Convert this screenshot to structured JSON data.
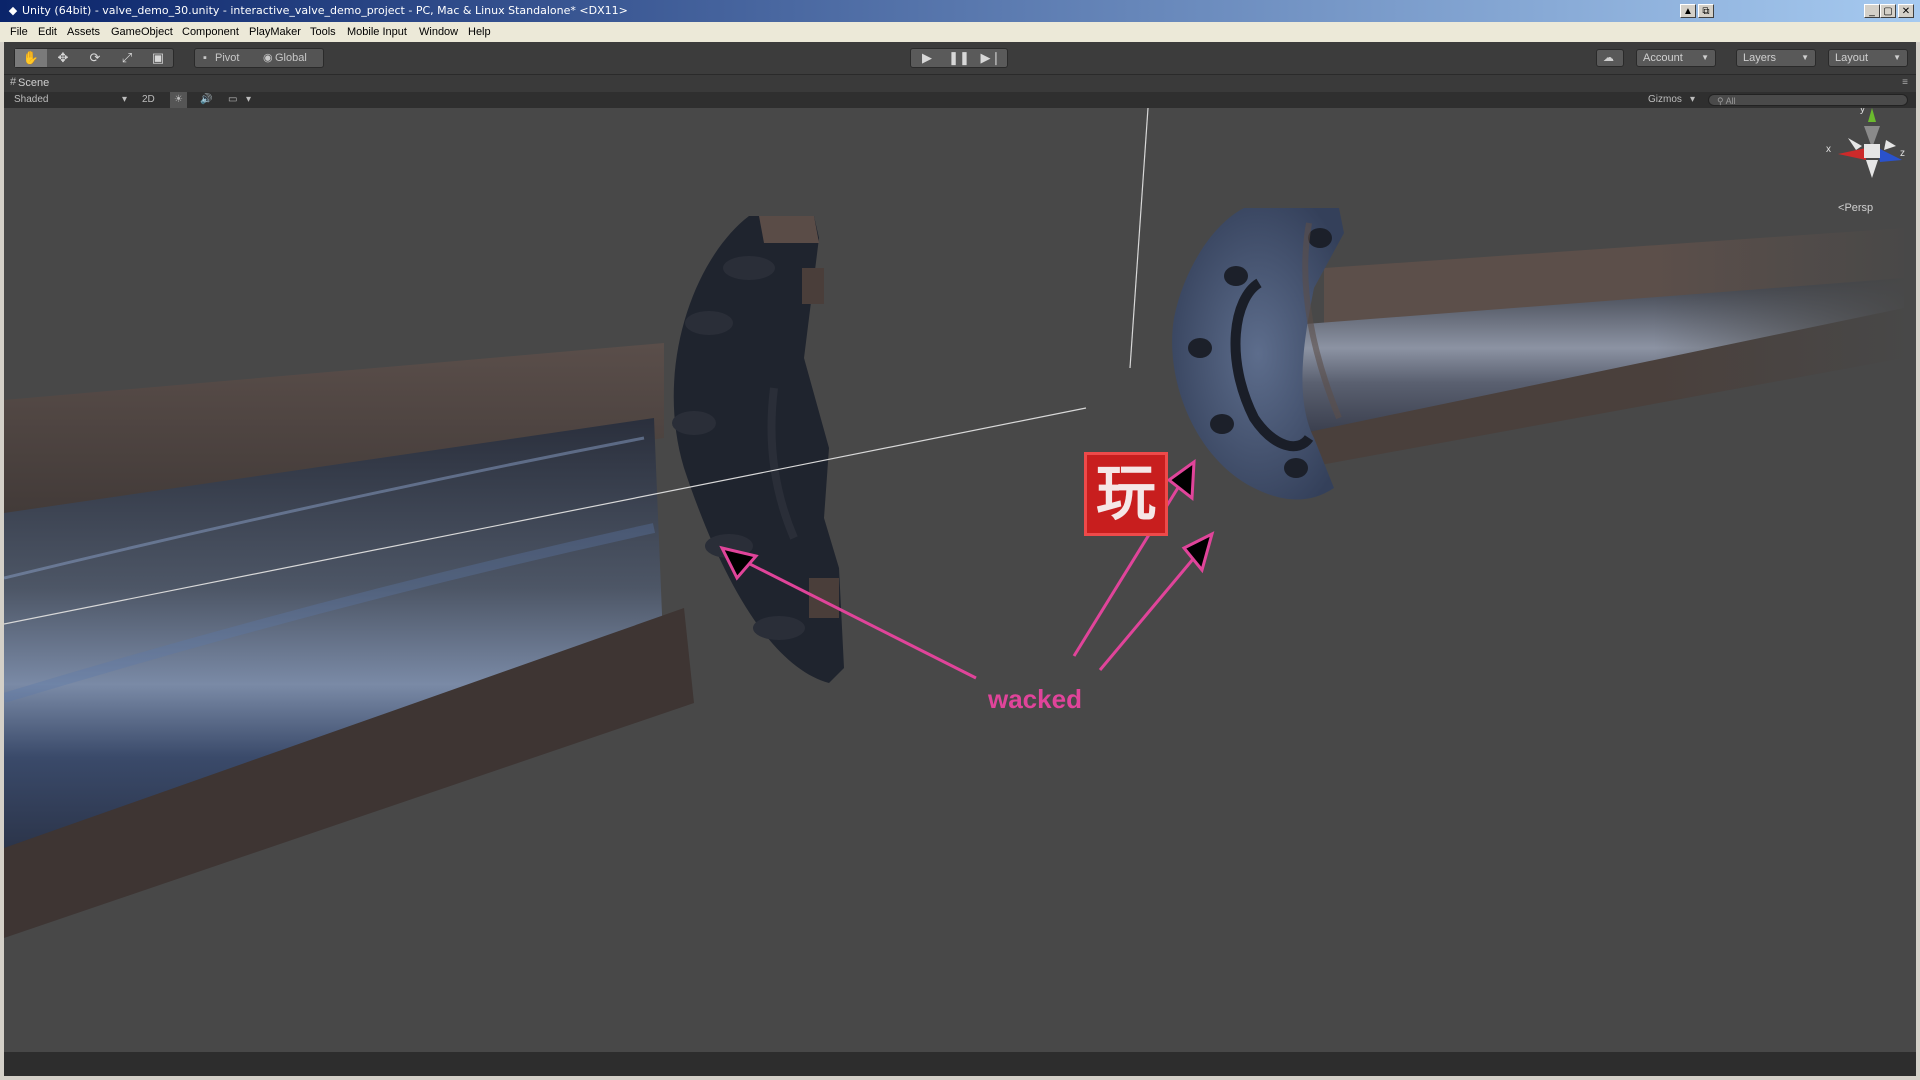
{
  "titlebar": {
    "title": "Unity (64bit) - valve_demo_30.unity - interactive_valve_demo_project - PC, Mac & Linux Standalone* <DX11>",
    "app_icon": "unity-icon",
    "buttons": [
      "minimize-icon",
      "restore-icon",
      "close-icon"
    ]
  },
  "menu": {
    "items": [
      "File",
      "Edit",
      "Assets",
      "GameObject",
      "Component",
      "PlayMaker",
      "Tools",
      "Mobile Input",
      "Window",
      "Help"
    ]
  },
  "toolbar": {
    "tools": [
      "hand-icon",
      "move-icon",
      "rotate-icon",
      "scale-icon",
      "rect-tool-icon"
    ],
    "pivot_label": "Pivot",
    "global_label": "Global",
    "play_controls": [
      "play-icon",
      "pause-icon",
      "step-icon"
    ],
    "cloud_icon": "cloud-icon",
    "account_label": "Account",
    "layers_label": "Layers",
    "layout_label": "Layout"
  },
  "scene": {
    "tab_label": "Scene",
    "shading_label": "Shaded",
    "mode_2d": "2D",
    "lighting_icon": "sun-icon",
    "audio_icon": "speaker-icon",
    "effects_icon": "image-icon",
    "gizmos_label": "Gizmos",
    "search_placeholder": "All",
    "persp_label": "Persp",
    "axes": {
      "x": "x",
      "y": "y",
      "z": "z"
    }
  },
  "annotation": {
    "text": "wacked",
    "color": "#e0449a",
    "stamp_glyph": "玩",
    "stamp_color": "#c81e1e"
  }
}
